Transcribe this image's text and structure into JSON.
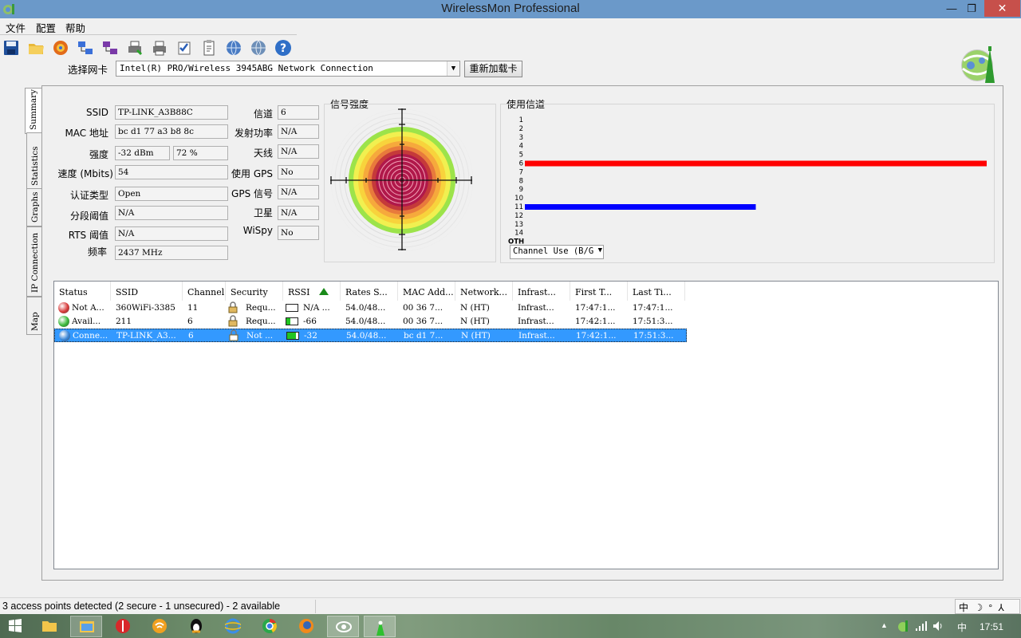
{
  "window": {
    "title": "WirelessMon Professional"
  },
  "menu": [
    "文件",
    "配置",
    "帮助"
  ],
  "adapter": {
    "label": "选择网卡",
    "selected": "Intel(R) PRO/Wireless 3945ABG Network Connection",
    "reload_label": "重新加载卡"
  },
  "tabs": [
    "Summary",
    "Statistics",
    "Graphs",
    "IP Connection",
    "Map"
  ],
  "summary": {
    "ssid_label": "SSID",
    "ssid": "TP-LINK_A3B88C",
    "mac_label": "MAC 地址",
    "mac": "bc d1 77 a3 b8 8c",
    "strength_label": "强度",
    "strength_dbm": "-32 dBm",
    "strength_pct": "72 %",
    "speed_label": "速度 (Mbits)",
    "speed": "54",
    "auth_label": "认证类型",
    "auth": "Open",
    "frag_label": "分段阈值",
    "frag": "N/A",
    "rts_label": "RTS 阈值",
    "rts": "N/A",
    "freq_label": "频率",
    "freq": "2437 MHz",
    "channel_label": "信道",
    "channel": "6",
    "txpower_label": "发射功率",
    "txpower": "N/A",
    "antenna_label": "天线",
    "antenna": "N/A",
    "gps_label": "使用 GPS",
    "gps": "No",
    "gps_signal_label": "GPS 信号",
    "gps_signal": "N/A",
    "satellite_label": "卫星",
    "satellite": "N/A",
    "wispy_label": "WiSpy",
    "wispy": "No"
  },
  "signal_panel": {
    "title": "信号强度"
  },
  "channel_panel": {
    "title": "使用信道",
    "channels": [
      "1",
      "2",
      "3",
      "4",
      "5",
      "6",
      "7",
      "8",
      "9",
      "10",
      "11",
      "12",
      "13",
      "14",
      "OTH"
    ],
    "usage": [
      {
        "channel": "6",
        "color": "#ff0000",
        "fraction": 1.0
      },
      {
        "channel": "11",
        "color": "#0000ff",
        "fraction": 0.5
      }
    ],
    "view_select": "Channel Use (B/G"
  },
  "table": {
    "columns": [
      "Status",
      "SSID",
      "Channel",
      "Security",
      "RSSI",
      "Rates S...",
      "MAC Add...",
      "Network...",
      "Infrast...",
      "First T...",
      "Last Ti..."
    ],
    "rows": [
      {
        "status": "Not A...",
        "status_color": "#d83a3a",
        "ssid": "360WiFi-3385",
        "channel": "11",
        "security": "Requ...",
        "rssi": "N/A ...",
        "rssi_level": 0,
        "rates": "54.0/48...",
        "mac": "00 36 7...",
        "network": "N (HT)",
        "infra": "Infrast...",
        "first": "17:47:1...",
        "last": "17:47:1..."
      },
      {
        "status": "Avail...",
        "status_color": "#39b839",
        "ssid": "211",
        "channel": "6",
        "security": "Requ...",
        "rssi": "-66",
        "rssi_level": 0.35,
        "rates": "54.0/48...",
        "mac": "00 36 7...",
        "network": "N (HT)",
        "infra": "Infrast...",
        "first": "17:42:1...",
        "last": "17:51:3..."
      },
      {
        "status": "Conne...",
        "status_color": "#3a86d8",
        "ssid": "TP-LINK_A3...",
        "channel": "6",
        "security": "Not ...",
        "rssi": "-32",
        "rssi_level": 0.75,
        "rates": "54.0/48...",
        "mac": "bc d1 7...",
        "network": "N (HT)",
        "infra": "Infrast...",
        "first": "17:42:1...",
        "last": "17:51:3..."
      }
    ]
  },
  "statusbar": {
    "text": "3 access points detected (2 secure - 1 unsecured) - 2 available",
    "ime": "中 ☽ ° ⅄ 宏"
  },
  "taskbar": {
    "clock": "17:51"
  }
}
